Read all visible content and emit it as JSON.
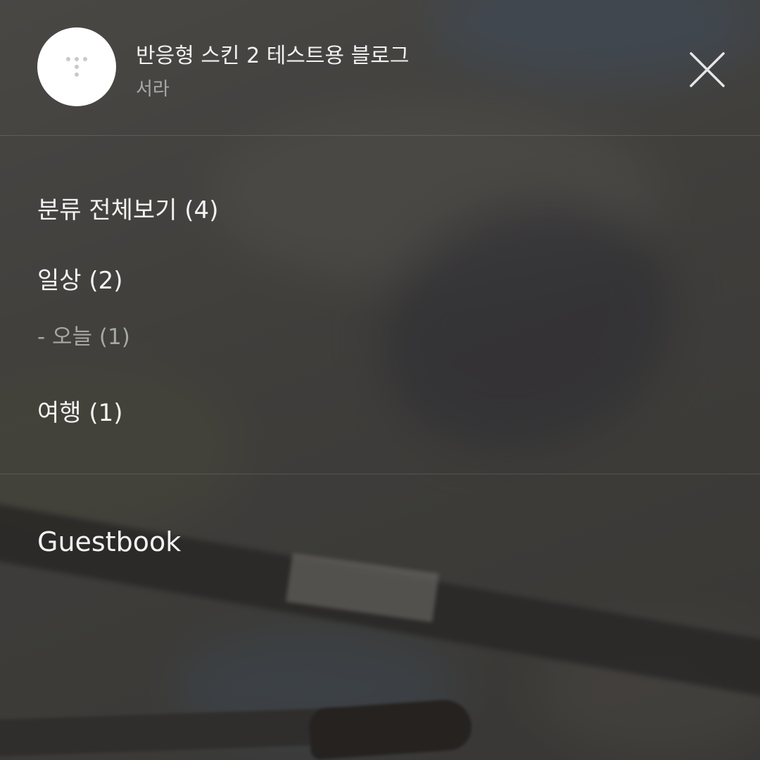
{
  "header": {
    "blog_title": "반응형 스킨 2 테스트용 블로그",
    "author": "서라",
    "avatar_icon": "tistory-t-logo-icon",
    "close_icon": "close-icon"
  },
  "categories": [
    {
      "label": "분류 전체보기 (4)",
      "level": 0
    },
    {
      "label": "일상 (2)",
      "level": 0
    },
    {
      "label": "- 오늘 (1)",
      "level": 1
    },
    {
      "label": "여행 (1)",
      "level": 0
    }
  ],
  "links": {
    "guestbook": "Guestbook"
  },
  "colors": {
    "primary_text": "#f3f3f3",
    "secondary_text": "#a9a9a9",
    "divider": "rgba(255,255,255,0.13)"
  }
}
